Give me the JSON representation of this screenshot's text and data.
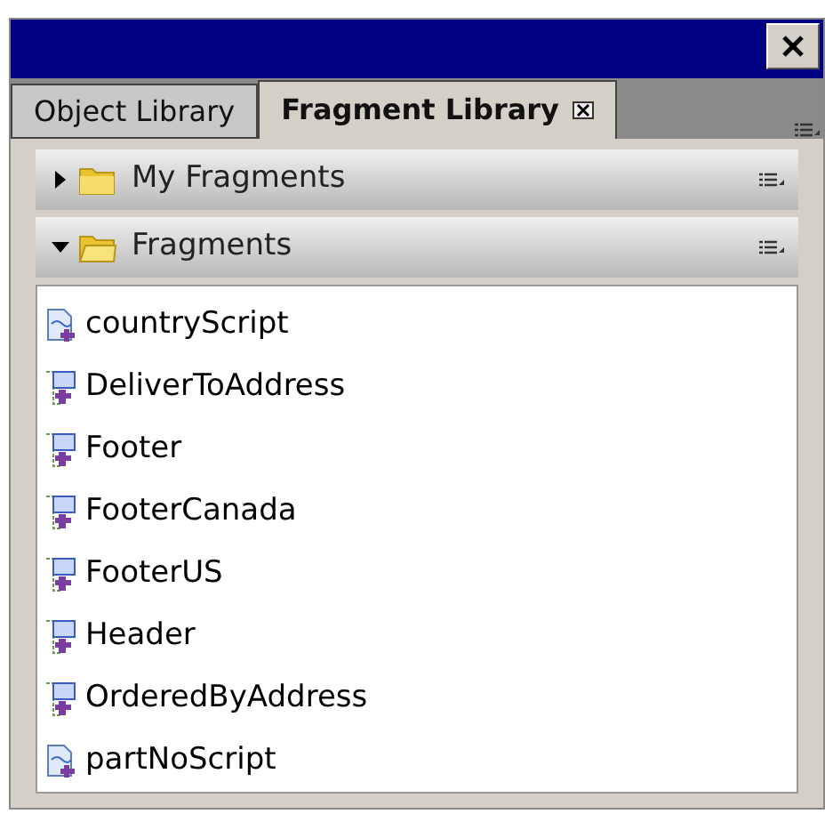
{
  "tabs": [
    {
      "label": "Object Library",
      "selected": false
    },
    {
      "label": "Fragment Library",
      "selected": true
    }
  ],
  "sections": [
    {
      "title": "My Fragments",
      "expanded": false
    },
    {
      "title": "Fragments",
      "expanded": true,
      "items": [
        {
          "name": "countryScript",
          "kind": "script"
        },
        {
          "name": "DeliverToAddress",
          "kind": "fragment"
        },
        {
          "name": "Footer",
          "kind": "fragment"
        },
        {
          "name": "FooterCanada",
          "kind": "fragment"
        },
        {
          "name": "FooterUS",
          "kind": "fragment"
        },
        {
          "name": "Header",
          "kind": "fragment"
        },
        {
          "name": "OrderedByAddress",
          "kind": "fragment"
        },
        {
          "name": "partNoScript",
          "kind": "script"
        }
      ]
    }
  ]
}
